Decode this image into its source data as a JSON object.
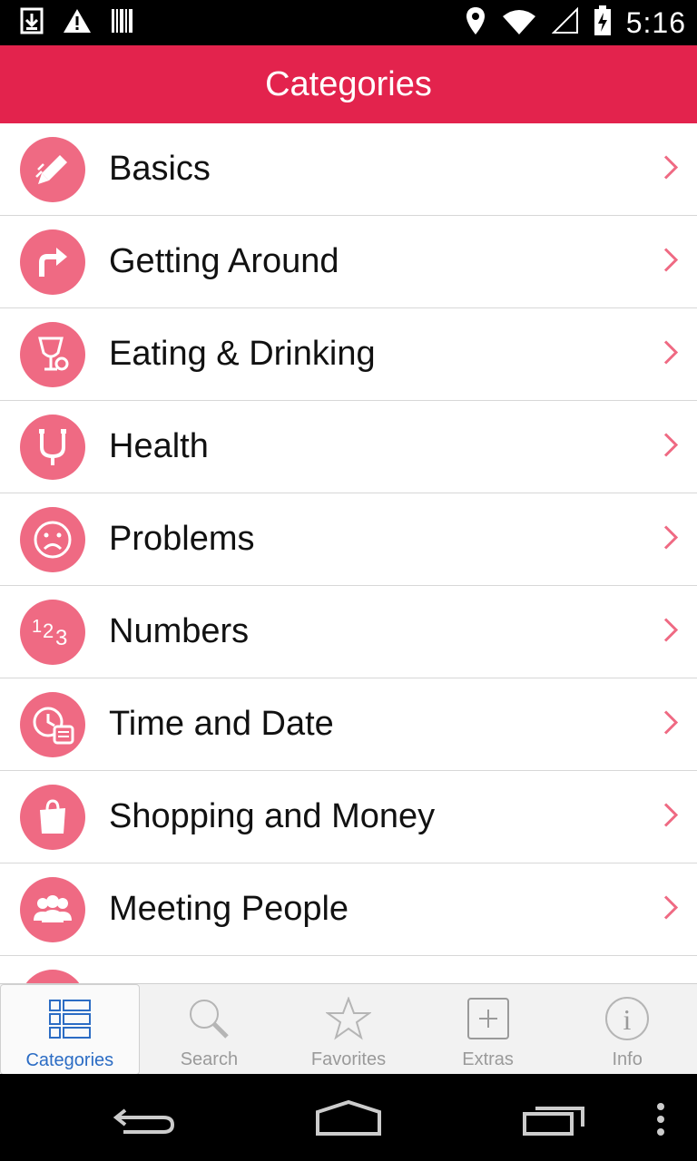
{
  "status_bar": {
    "time": "5:16",
    "left_icons": [
      "download-icon",
      "warning-icon",
      "barcode-icon"
    ],
    "right_icons": [
      "location-icon",
      "wifi-icon",
      "signal-icon",
      "battery-icon"
    ]
  },
  "header": {
    "title": "Categories"
  },
  "categories": [
    {
      "label": "Basics",
      "icon": "pencil-icon"
    },
    {
      "label": "Getting Around",
      "icon": "turn-arrow-icon"
    },
    {
      "label": "Eating & Drinking",
      "icon": "glass-icon"
    },
    {
      "label": "Health",
      "icon": "stethoscope-icon"
    },
    {
      "label": "Problems",
      "icon": "sad-face-icon"
    },
    {
      "label": "Numbers",
      "icon": "numbers-icon"
    },
    {
      "label": "Time and Date",
      "icon": "clock-calendar-icon"
    },
    {
      "label": "Shopping and Money",
      "icon": "shopping-bag-icon"
    },
    {
      "label": "Meeting People",
      "icon": "people-icon"
    }
  ],
  "tabs": [
    {
      "label": "Categories",
      "icon": "list-icon",
      "active": true
    },
    {
      "label": "Search",
      "icon": "search-icon",
      "active": false
    },
    {
      "label": "Favorites",
      "icon": "star-icon",
      "active": false
    },
    {
      "label": "Extras",
      "icon": "plus-box-icon",
      "active": false
    },
    {
      "label": "Info",
      "icon": "info-icon",
      "active": false
    }
  ],
  "colors": {
    "accent": "#e3234d",
    "icon_bg": "#ef6a83",
    "tab_active": "#2b6cc4"
  }
}
